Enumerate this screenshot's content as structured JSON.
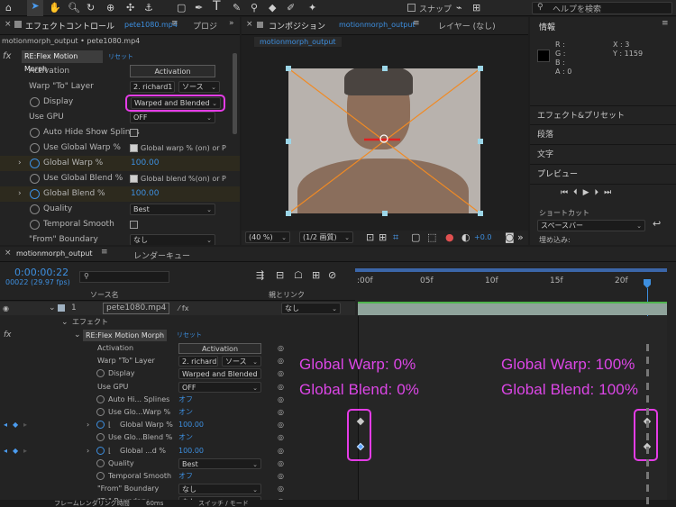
{
  "toolbar": {
    "snap_label": "スナップ",
    "help_search_placeholder": "ヘルプを検索"
  },
  "effect_panel": {
    "tab_label": "エフェクトコントロール",
    "tab_file": "pete1080.mp4",
    "tab2_label": "プロジ",
    "subtitle": "motionmorph_output • pete1080.mp4",
    "effect_name": "RE:Flex Motion Morph",
    "reset_label": "リセット",
    "rows": {
      "activation": {
        "label": "Activation",
        "button": "Activation"
      },
      "warp_to": {
        "label": "Warp \"To\" Layer",
        "value1": "2. richard1",
        "value2": "ソース"
      },
      "display": {
        "label": "Display",
        "value": "Warped and Blended"
      },
      "gpu": {
        "label": "Use GPU",
        "value": "OFF"
      },
      "auto_hide": {
        "label": "Auto Hide Show Splines"
      },
      "use_global_warp": {
        "label": "Use Global Warp %",
        "checkbox_label": "Global warp % (on) or P"
      },
      "global_warp": {
        "label": "Global Warp %",
        "value": "100.00"
      },
      "use_global_blend": {
        "label": "Use Global Blend %",
        "checkbox_label": "Global blend %(on) or P"
      },
      "global_blend": {
        "label": "Global Blend %",
        "value": "100.00"
      },
      "quality": {
        "label": "Quality",
        "value": "Best"
      },
      "temporal": {
        "label": "Temporal Smooth"
      },
      "from_boundary": {
        "label": "\"From\" Boundary",
        "value": "なし"
      }
    }
  },
  "comp_panel": {
    "tab_label": "コンポジション",
    "tab_name": "motionmorph_output",
    "layer_label": "レイヤー (なし)",
    "breadcrumb": "motionmorph_output",
    "zoom": "(40 %)",
    "resolution": "(1/2 画質)",
    "exposure": "+0.0"
  },
  "right_panel": {
    "info_label": "情報",
    "r": "R :",
    "g": "G :",
    "b": "B :",
    "a": "A : 0",
    "x": "X : 3",
    "y": "Y : 1159",
    "effects_presets": "エフェクト&プリセット",
    "paragraph": "段落",
    "character": "文字",
    "preview": "プレビュー",
    "shortcut_label": "ショートカット",
    "shortcut_value": "スペースバー",
    "embed_label": "埋め込み:"
  },
  "timeline": {
    "tab_label": "motionmorph_output",
    "render_queue": "レンダーキュー",
    "timecode": "0:00:00:22",
    "frames": "00022 (29.97 fps)",
    "col_source": "ソース名",
    "col_parent": "親とリンク",
    "ruler": [
      ":00f",
      "05f",
      "10f",
      "15f",
      "20f"
    ],
    "layer_index": "1",
    "layer_name": "pete1080.mp4",
    "parent_value": "なし",
    "effects_group": "エフェクト",
    "effect_name": "RE:Flex Motion Morph",
    "reset_label": "リセット",
    "rows": {
      "activation": {
        "label": "Activation",
        "button": "Activation"
      },
      "warp_to": {
        "label": "Warp \"To\" Layer",
        "value1": "2. richard",
        "value2": "ソース"
      },
      "display": {
        "label": "Display",
        "value": "Warped and Blended"
      },
      "gpu": {
        "label": "Use GPU",
        "value": "OFF"
      },
      "auto_hide": {
        "label": "Auto Hi... Splines",
        "value": "オフ"
      },
      "use_global_warp": {
        "label": "Use Glo...Warp %",
        "value": "オン"
      },
      "global_warp": {
        "label": "Global Warp %",
        "value": "100.00"
      },
      "use_global_blend": {
        "label": "Use Glo...Blend %",
        "value": "オン"
      },
      "global_blend": {
        "label": "Global ...d %",
        "value": "100.00"
      },
      "quality": {
        "label": "Quality",
        "value": "Best"
      },
      "temporal": {
        "label": "Temporal Smooth",
        "value": "オフ"
      },
      "from_boundary": {
        "label": "\"From\" Boundary",
        "value": "なし"
      },
      "to_boundary": {
        "label": "\"To\" Boundary",
        "value": "なし"
      }
    },
    "footer_render": "フレームレンダリング時間",
    "footer_time": "60ms",
    "footer_switch": "スイッチ / モード"
  },
  "annotations": {
    "left_warp": "Global Warp: 0%",
    "left_blend": "Global Blend: 0%",
    "right_warp": "Global Warp: 100%",
    "right_blend": "Global Blend: 100%"
  },
  "colors": {
    "accent_blue": "#3d8fe0",
    "highlight_magenta": "#e43ce6",
    "morph_line_orange": "#f08a24"
  }
}
